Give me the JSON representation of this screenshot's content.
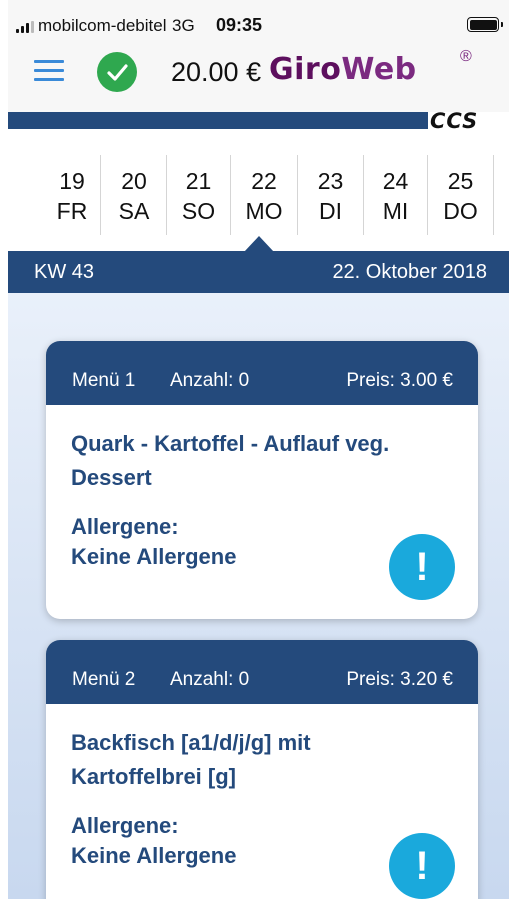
{
  "status_bar": {
    "carrier": "mobilcom-debitel",
    "network": "3G",
    "time": "09:35"
  },
  "header": {
    "balance": "20.00 €",
    "brand_part1": "Giro",
    "brand_part2": "Web",
    "registered_mark": "®",
    "brand_secondary": "CCS"
  },
  "days": [
    {
      "num": "19",
      "name": "FR",
      "selected": false
    },
    {
      "num": "20",
      "name": "SA",
      "selected": false
    },
    {
      "num": "21",
      "name": "SO",
      "selected": false
    },
    {
      "num": "22",
      "name": "MO",
      "selected": true
    },
    {
      "num": "23",
      "name": "DI",
      "selected": false
    },
    {
      "num": "24",
      "name": "MI",
      "selected": false
    },
    {
      "num": "25",
      "name": "DO",
      "selected": false
    }
  ],
  "week_bar": {
    "week": "KW 43",
    "date": "22. Oktober 2018"
  },
  "menus": [
    {
      "menu": "Menü 1",
      "count": "Anzahl: 0",
      "price": "Preis: 3.00 €",
      "dish_line1": "Quark - Kartoffel - Auflauf veg.",
      "dish_line2": "Dessert",
      "allergen_title": "Allergene:",
      "allergen_value": "Keine Allergene",
      "info_icon": "!"
    },
    {
      "menu": "Menü 2",
      "count": "Anzahl: 0",
      "price": "Preis: 3.20 €",
      "dish_line1": "Backfisch [a1/d/j/g] mit",
      "dish_line2": "Kartoffelbrei [g]",
      "allergen_title": "Allergene:",
      "allergen_value": "Keine Allergene",
      "info_icon": "!"
    }
  ],
  "colors": {
    "primary": "#244a7c",
    "accent_blue": "#3a8ad8",
    "success": "#2fa84f",
    "brand": "#5d0f5e",
    "info": "#1aa9dc"
  },
  "icons": {
    "menu": "hamburger-icon",
    "status": "checkmark-icon",
    "info": "exclamation-icon"
  }
}
